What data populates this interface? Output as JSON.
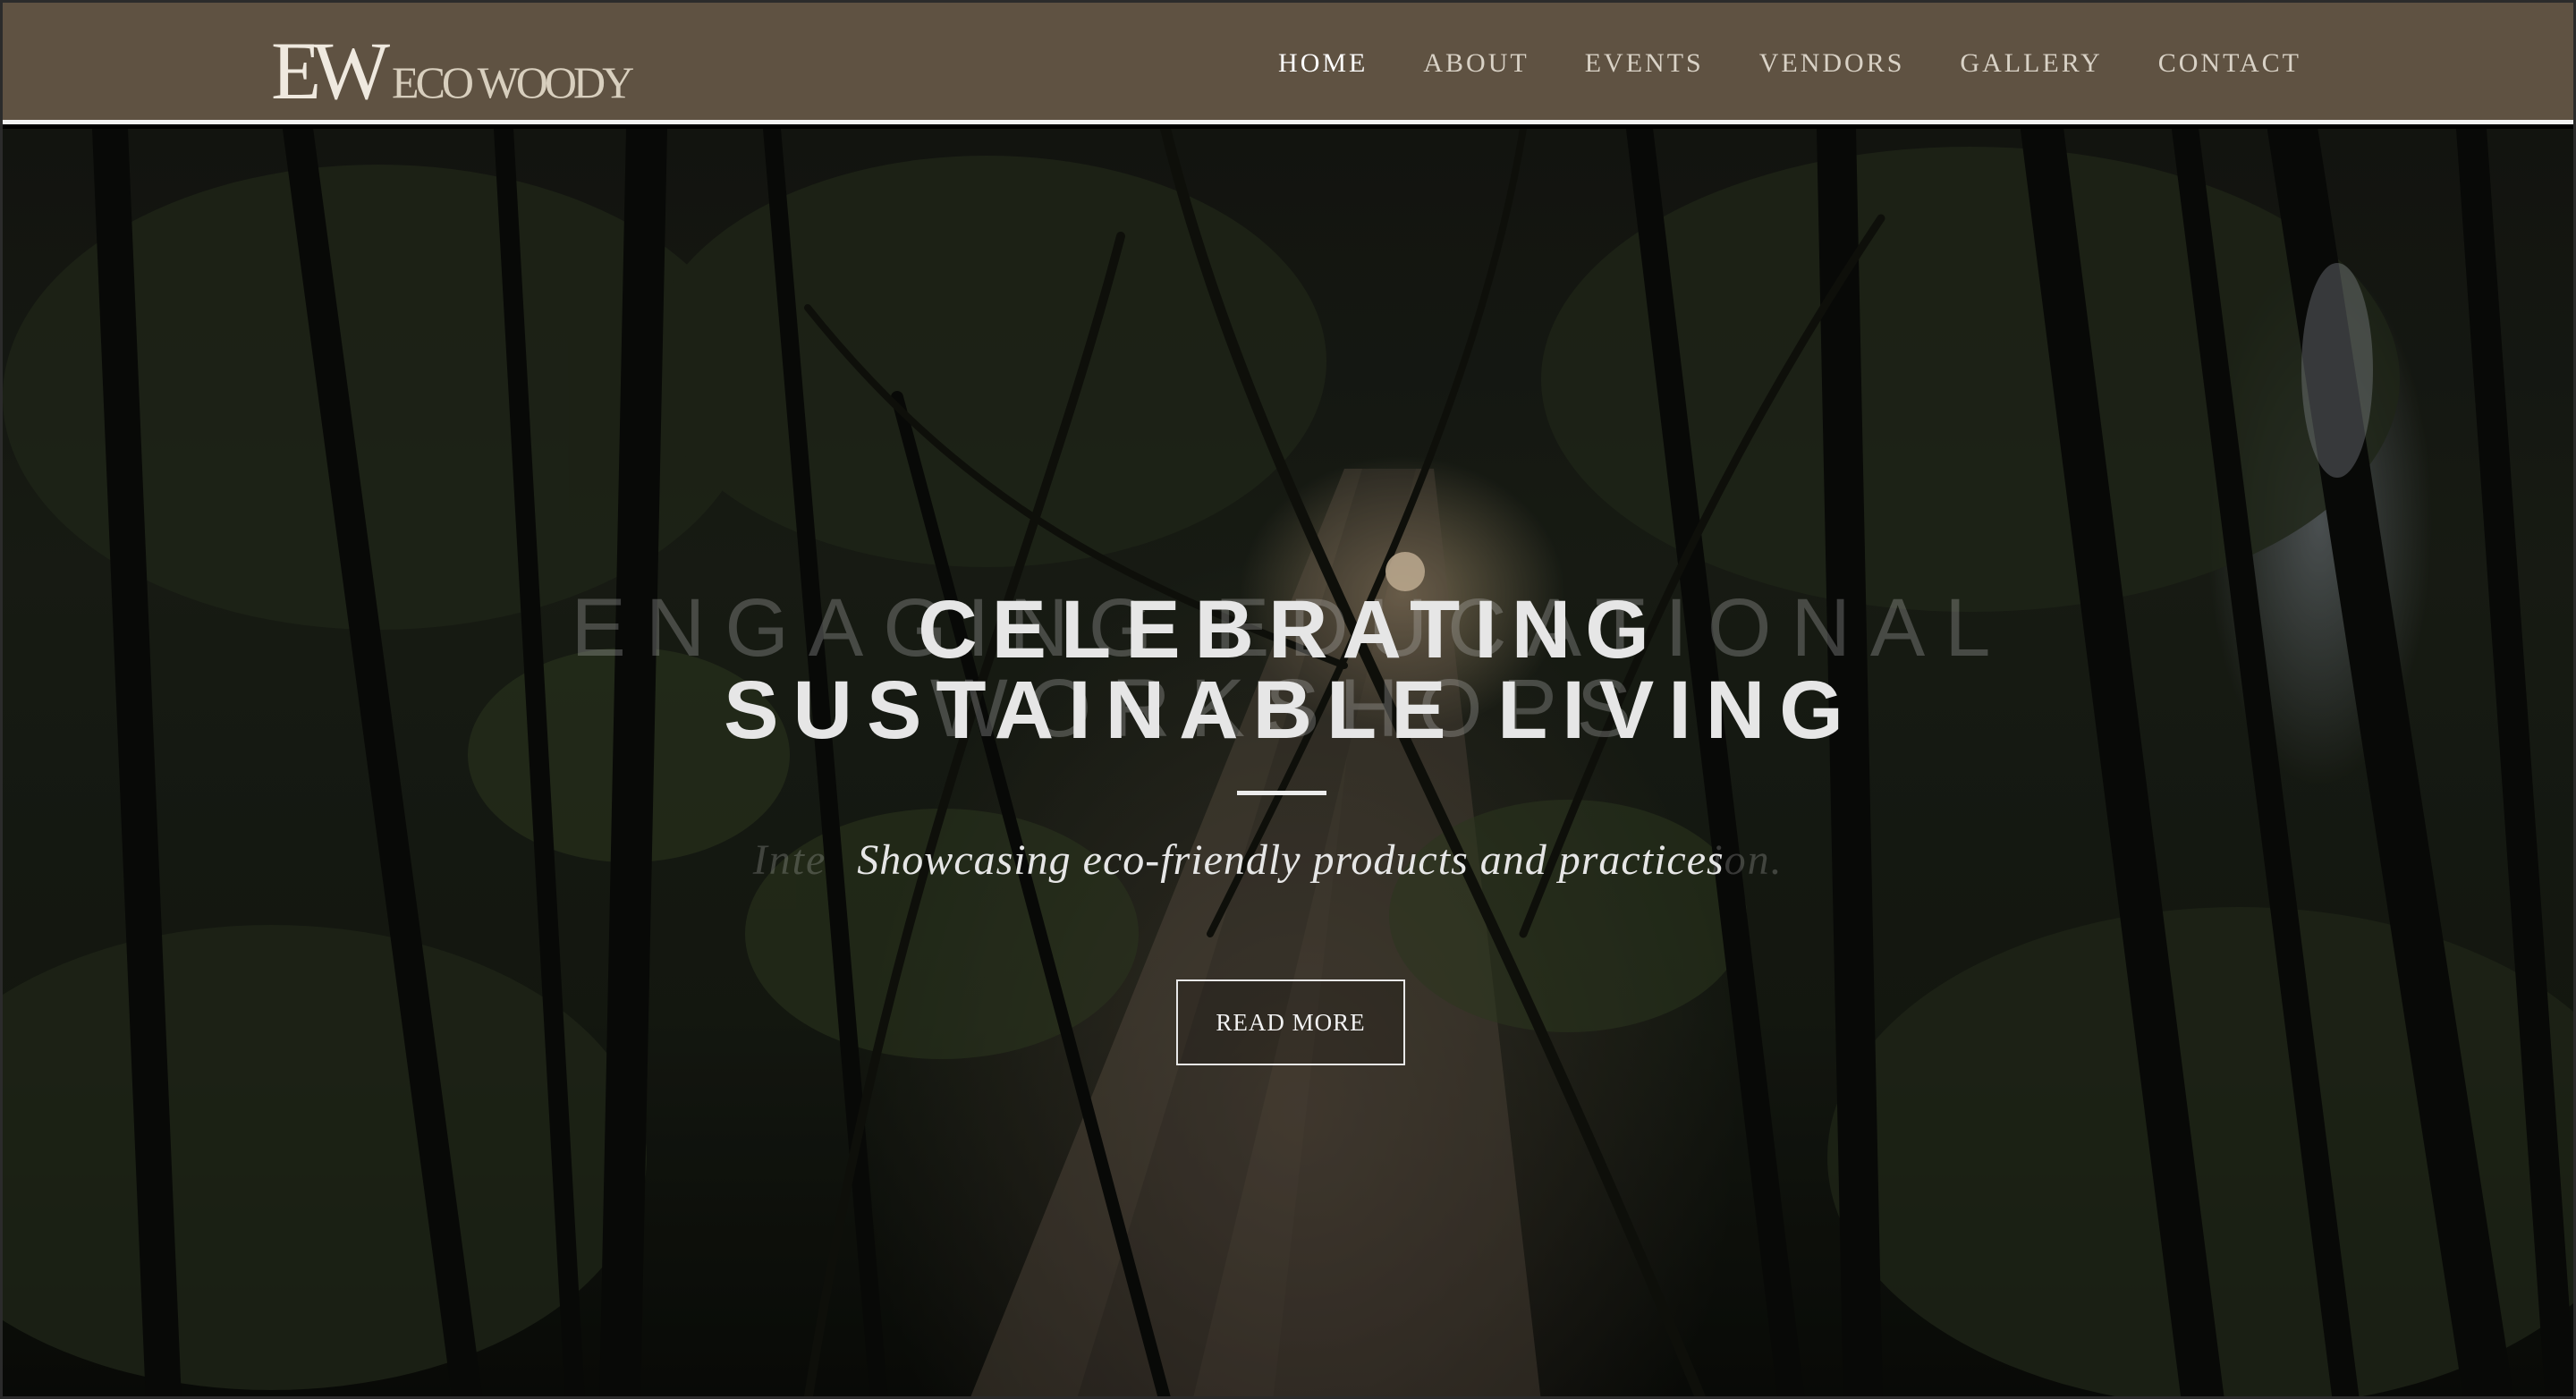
{
  "header": {
    "logo_mark": "EW",
    "logo_word": "ECO WOODY",
    "nav": [
      {
        "label": "HOME",
        "active": true
      },
      {
        "label": "ABOUT",
        "active": false
      },
      {
        "label": "EVENTS",
        "active": false
      },
      {
        "label": "VENDORS",
        "active": false
      },
      {
        "label": "GALLERY",
        "active": false
      },
      {
        "label": "CONTACT",
        "active": false
      }
    ]
  },
  "hero": {
    "background_image": "forest-sunrays",
    "title_line1": "CELEBRATING",
    "title_line2": "SUSTAINABLE LIVING",
    "subtitle": "Showcasing eco-friendly products and practices",
    "button_label": "READ MORE",
    "previous_slide": {
      "title_line1": "ENGAGING EDUCATIONAL",
      "title_line2": "WORKSHOPS",
      "subtitle_visible_start": "Inte",
      "subtitle_visible_end": "ion."
    }
  },
  "colors": {
    "header_bg": "#5f5242",
    "header_border": "#f2f2f2",
    "nav_text": "#d9d2c6",
    "hero_text": "#e6e6e6"
  }
}
